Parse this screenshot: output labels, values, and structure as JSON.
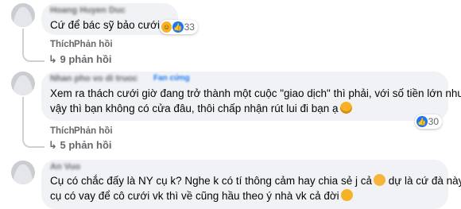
{
  "comments": [
    {
      "author": "Hoang Huyen Duc",
      "text": "Cứ để bác sỹ bảo cưới",
      "reactions": {
        "count": "33",
        "icons": [
          "haha-reaction-icon",
          "like-reaction-icon"
        ]
      },
      "like_action": "Thích",
      "reply_action": "Phản hồi",
      "replies_label": "9 phản hồi"
    },
    {
      "author": "Nhan pho vo di truoc",
      "badge": "Fan cứng",
      "lines": [
        "Xem ra thách cưới giờ đang trở thành một cuộc \"giao dịch\" thì phải, với số tiền lớn như",
        "vậy thì bạn không có cửa đâu, thôi chấp nhận rút lui đi bạn ạ"
      ],
      "reactions": {
        "count": "30",
        "icons": [
          "like-reaction-icon"
        ]
      },
      "like_action": "Thích",
      "reply_action": "Phản hồi",
      "replies_label": "5 phản hồi"
    },
    {
      "author": "An Vuo",
      "lines": [
        "Cụ có chắc đấy là NY cụ k? Nghe k có tí thông cảm hay chia sẻ j cả",
        "cụ có vay để cô cưới vk thì về cũng hầu theo ý nhà vk cả đời"
      ],
      "line1_tail": "dự là cứ đà này"
    }
  ],
  "colors": {
    "bubble": "#f0f2f5",
    "secondary_text": "#65676b",
    "accent": "#1877f2"
  }
}
